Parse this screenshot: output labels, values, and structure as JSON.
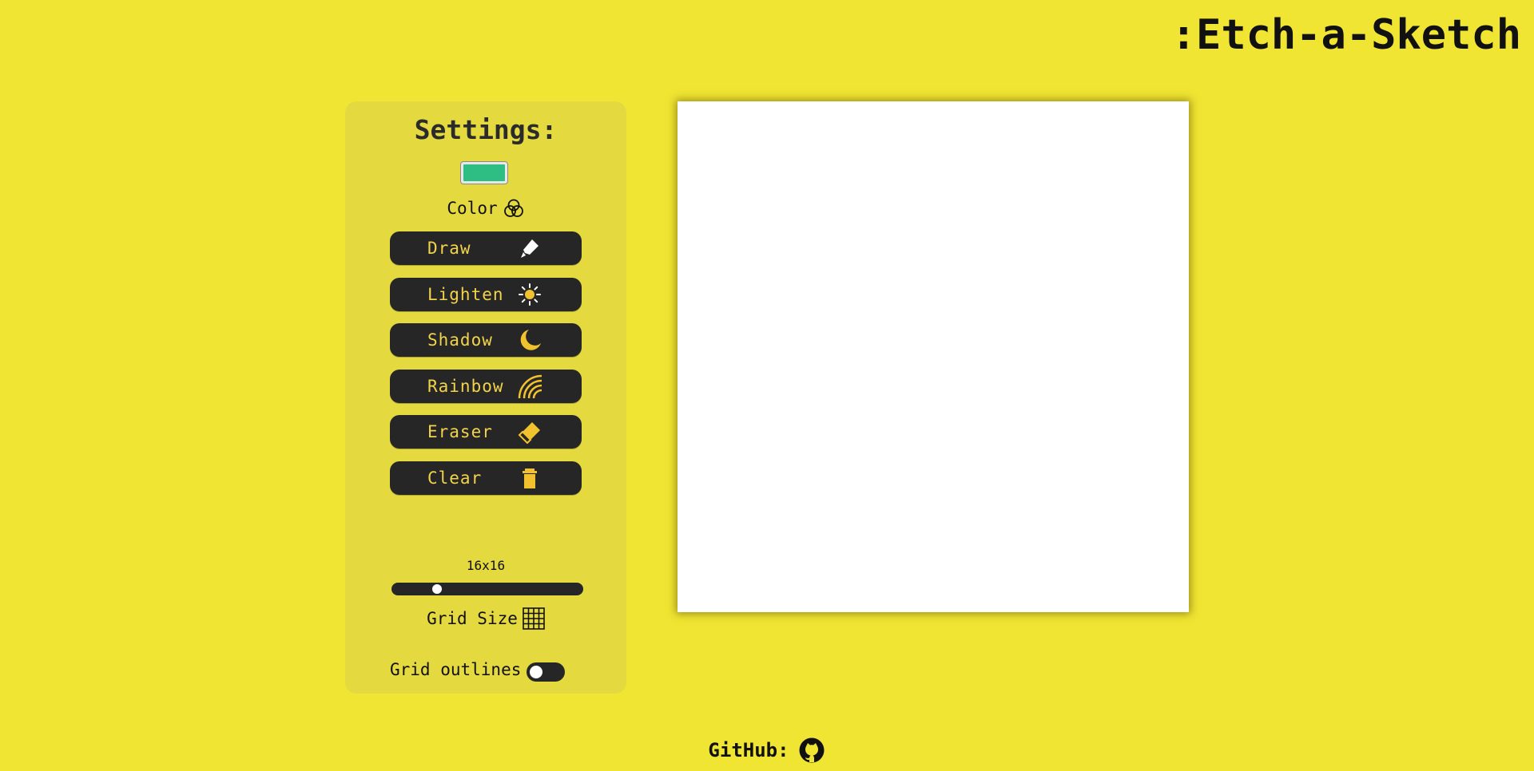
{
  "header": {
    "title": ":Etch-a-Sketch"
  },
  "settings": {
    "title": "Settings:",
    "color": {
      "label": "Color",
      "value": "#2ebd82",
      "icon": "color-circles-icon"
    },
    "buttons": [
      {
        "label": "Draw",
        "icon": "pen-icon"
      },
      {
        "label": "Lighten",
        "icon": "sun-icon"
      },
      {
        "label": "Shadow",
        "icon": "moon-icon"
      },
      {
        "label": "Rainbow",
        "icon": "rainbow-icon"
      },
      {
        "label": "Eraser",
        "icon": "eraser-icon"
      },
      {
        "label": "Clear",
        "icon": "trash-icon"
      }
    ],
    "grid": {
      "size_text": "16x16",
      "label": "Grid Size",
      "icon": "grid-icon",
      "slider_fraction": 0.22
    },
    "outlines": {
      "label": "Grid outlines",
      "enabled": false
    }
  },
  "footer": {
    "label": "GitHub:",
    "icon": "github-icon"
  },
  "colors": {
    "background": "#f0e532",
    "panel": "#e4d93f",
    "button": "#262626",
    "accent": "#f2d34a"
  }
}
